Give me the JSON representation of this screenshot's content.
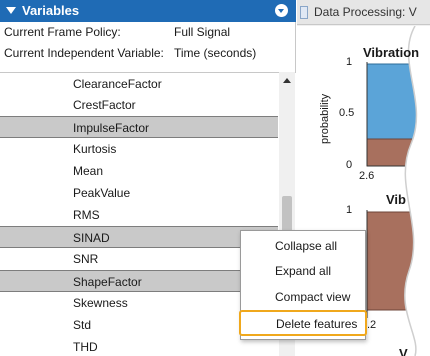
{
  "variables_panel": {
    "title": "Variables",
    "frame_policy_label": "Current Frame Policy:",
    "frame_policy_value": "Full Signal",
    "indep_var_label": "Current Independent Variable:",
    "indep_var_value": "Time (seconds)"
  },
  "features": [
    {
      "label": "ClearanceFactor",
      "selected": false
    },
    {
      "label": "CrestFactor",
      "selected": false
    },
    {
      "label": "ImpulseFactor",
      "selected": true
    },
    {
      "label": "Kurtosis",
      "selected": false
    },
    {
      "label": "Mean",
      "selected": false
    },
    {
      "label": "PeakValue",
      "selected": false
    },
    {
      "label": "RMS",
      "selected": false
    },
    {
      "label": "SINAD",
      "selected": true
    },
    {
      "label": "SNR",
      "selected": false
    },
    {
      "label": "ShapeFactor",
      "selected": true
    },
    {
      "label": "Skewness",
      "selected": false
    },
    {
      "label": "Std",
      "selected": false
    },
    {
      "label": "THD",
      "selected": false
    }
  ],
  "right_panel": {
    "tab_label": "Data Processing: V",
    "plot1_title": "Vibration",
    "plot1_ylabel": "probability",
    "plot1_yticks": [
      "1",
      "0.5",
      "0"
    ],
    "plot1_xtick": "2.6",
    "plot2_title": "Vib",
    "plot2_ytick_top": "1",
    "plot2_xtick": ".2",
    "plot3_title": "V"
  },
  "context_menu": {
    "items": [
      "Collapse all",
      "Expand all",
      "Compact view",
      "Delete features"
    ]
  },
  "colors": {
    "header_blue": "#1f6bb5",
    "selection_gray": "#c9c9c9",
    "hist_blue": "#5ba4d8",
    "hist_brown": "#a8705e",
    "highlight_orange": "#f0a81c"
  }
}
